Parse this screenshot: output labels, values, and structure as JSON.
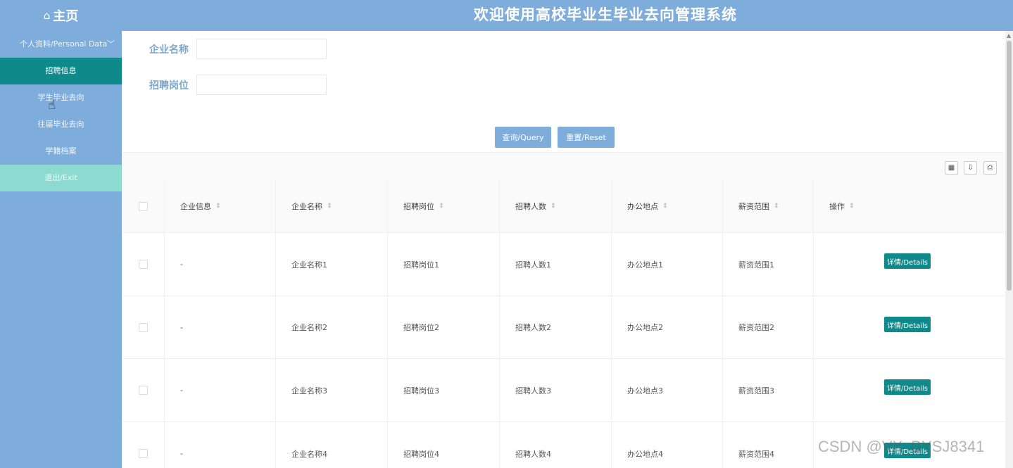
{
  "header": {
    "home_icon": "home-icon",
    "home_label": "主页",
    "title": "欢迎使用高校毕业生毕业去向管理系统"
  },
  "sidebar": {
    "items": [
      {
        "label": "个人资料/Personal Data"
      },
      {
        "label": "招聘信息"
      },
      {
        "label": "学生毕业去向"
      },
      {
        "label": "往届毕业去向"
      },
      {
        "label": "学籍档案"
      },
      {
        "label": "退出/Exit"
      }
    ]
  },
  "search": {
    "company_label": "企业名称",
    "company_value": "",
    "position_label": "招聘岗位",
    "position_value": "",
    "query_label": "查询/Query",
    "reset_label": "重置/Reset"
  },
  "toolbar": {
    "icons": [
      "columns-icon",
      "export-icon",
      "print-icon"
    ]
  },
  "table": {
    "columns": [
      "企业信息",
      "企业名称",
      "招聘岗位",
      "招聘人数",
      "办公地点",
      "薪资范围",
      "操作"
    ],
    "rows": [
      {
        "info": "-",
        "name": "企业名称1",
        "position": "招聘岗位1",
        "count": "招聘人数1",
        "location": "办公地点1",
        "salary": "薪资范围1",
        "action": "详情/Details"
      },
      {
        "info": "-",
        "name": "企业名称2",
        "position": "招聘岗位2",
        "count": "招聘人数2",
        "location": "办公地点2",
        "salary": "薪资范围2",
        "action": "详情/Details"
      },
      {
        "info": "-",
        "name": "企业名称3",
        "position": "招聘岗位3",
        "count": "招聘人数3",
        "location": "办公地点3",
        "salary": "薪资范围3",
        "action": "详情/Details"
      },
      {
        "info": "-",
        "name": "企业名称4",
        "position": "招聘岗位4",
        "count": "招聘人数4",
        "location": "办公地点4",
        "salary": "薪资范围4",
        "action": "详情/Details"
      }
    ]
  },
  "watermark": "CSDN @VX_BYSJ8341",
  "colors": {
    "header": "#7eacdb",
    "active": "#0f8a8a",
    "exit": "#8cdad0"
  }
}
